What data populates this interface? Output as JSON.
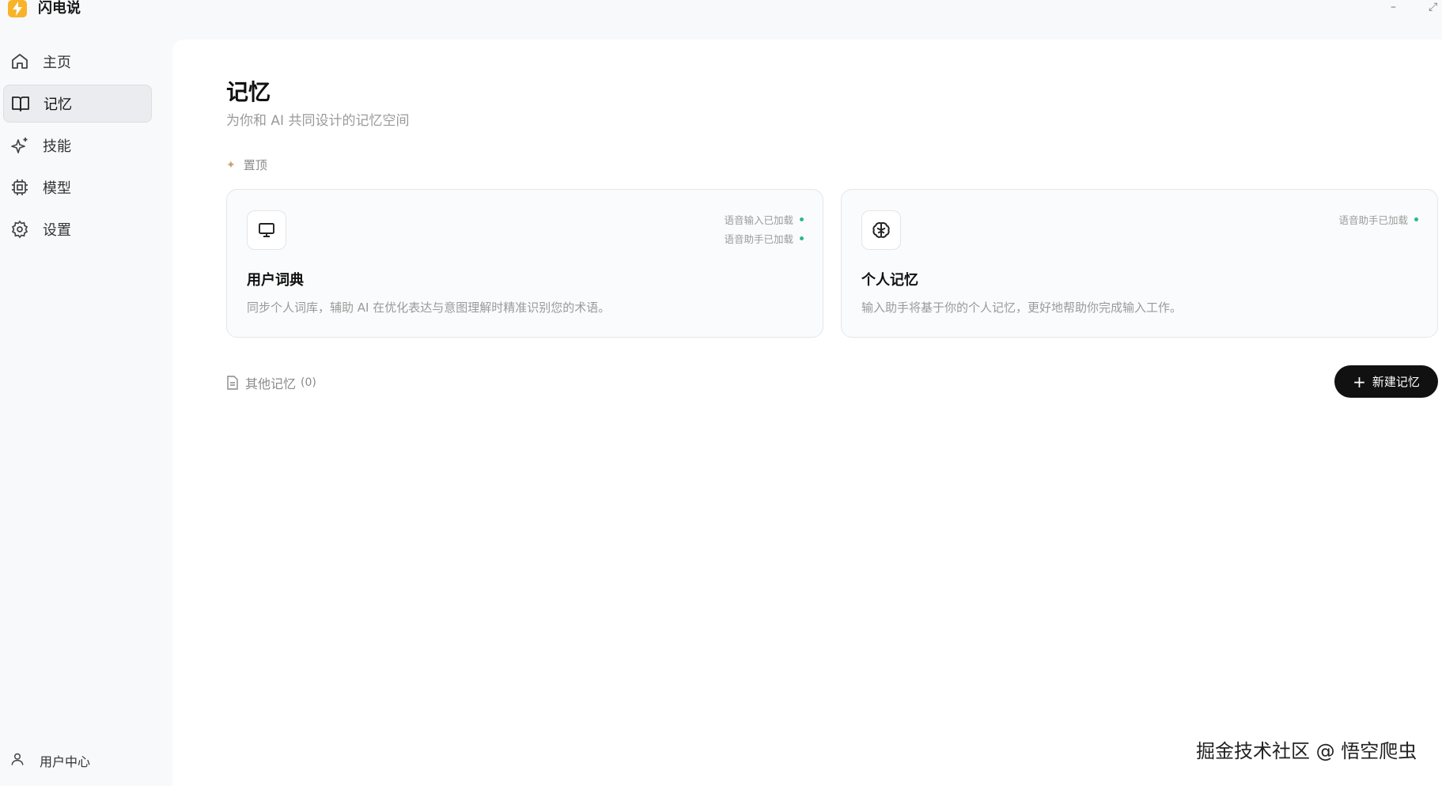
{
  "app": {
    "name": "闪电说"
  },
  "window_controls": {
    "minimize": "–",
    "maximize": "⤢"
  },
  "sidebar": {
    "items": [
      {
        "label": "主页",
        "icon": "home-icon"
      },
      {
        "label": "记忆",
        "icon": "book-icon",
        "active": true
      },
      {
        "label": "技能",
        "icon": "sparkles-icon"
      },
      {
        "label": "模型",
        "icon": "chip-icon"
      },
      {
        "label": "设置",
        "icon": "gear-icon"
      }
    ],
    "user_center": {
      "label": "用户中心",
      "icon": "user-icon"
    }
  },
  "main": {
    "title": "记忆",
    "subtitle": "为你和 AI 共同设计的记忆空间",
    "pinned": {
      "label": "置顶",
      "cards": [
        {
          "title": "用户词典",
          "description": "同步个人词库，辅助 AI 在优化表达与意图理解时精准识别您的术语。",
          "icon": "monitor-icon",
          "statuses": [
            "语音输入已加载",
            "语音助手已加载"
          ]
        },
        {
          "title": "个人记忆",
          "description": "输入助手将基于你的个人记忆，更好地帮助你完成输入工作。",
          "icon": "brain-icon",
          "statuses": [
            "语音助手已加载"
          ]
        }
      ]
    },
    "others": {
      "label": "其他记忆",
      "count": "(0)"
    },
    "new_button": {
      "label": "新建记忆"
    }
  },
  "watermark": "掘金技术社区 @ 悟空爬虫",
  "colors": {
    "accent": "#111111",
    "status_dot": "#2eb88a",
    "logo": "#f8b32a"
  }
}
